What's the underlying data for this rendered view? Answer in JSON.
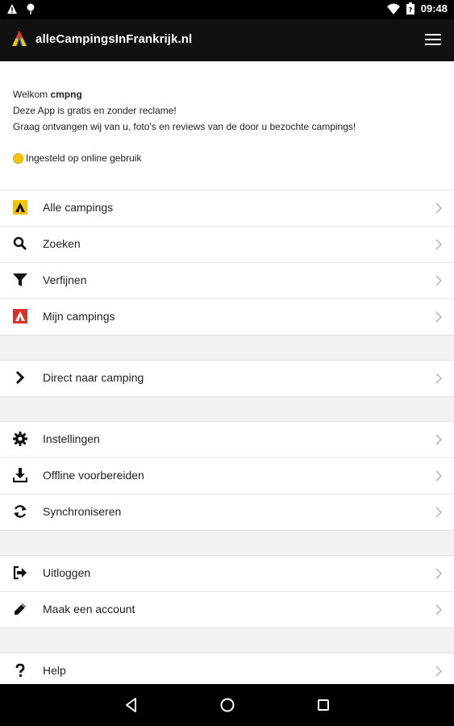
{
  "status_bar": {
    "time": "09:48",
    "left_icons": [
      "warning-icon",
      "location-pin-icon"
    ],
    "right_icons": [
      "wifi-icon",
      "battery-icon"
    ]
  },
  "app_bar": {
    "title": "alleCampingsInFrankrijk.nl",
    "logo_icon": "campings-logo-icon",
    "menu_icon": "hamburger-menu-icon"
  },
  "welcome": {
    "greeting_prefix": "Welkom ",
    "username": "cmpng",
    "line2": "Deze App is gratis en zonder reclame!",
    "line3": "Graag ontvangen wij van u, foto's en reviews van de door u bezochte campings!",
    "status_text": "Ingesteld op online gebruik",
    "status_color": "#f2c500"
  },
  "menu": {
    "group1": [
      {
        "label": "Alle campings",
        "icon": "tent-icon"
      },
      {
        "label": "Zoeken",
        "icon": "search-icon"
      },
      {
        "label": "Verfijnen",
        "icon": "filter-icon"
      },
      {
        "label": "Mijn campings",
        "icon": "my-campings-icon"
      }
    ],
    "group2": [
      {
        "label": "Direct naar camping",
        "icon": "chevron-right-icon"
      }
    ],
    "group3": [
      {
        "label": "Instellingen",
        "icon": "gear-icon"
      },
      {
        "label": "Offline voorbereiden",
        "icon": "download-icon"
      },
      {
        "label": "Synchroniseren",
        "icon": "sync-icon"
      }
    ],
    "group4": [
      {
        "label": "Uitloggen",
        "icon": "logout-icon"
      },
      {
        "label": "Maak een account",
        "icon": "pencil-icon"
      }
    ],
    "group5": [
      {
        "label": "Help",
        "icon": "question-icon"
      }
    ]
  },
  "nav_bar": {
    "back_icon": "back-triangle-icon",
    "home_icon": "home-circle-icon",
    "recents_icon": "recents-square-icon"
  },
  "colors": {
    "app_bar": "#111111",
    "tent_yellow": "#f5c400",
    "mijn_red": "#d9322b",
    "background": "#f2f2f2"
  }
}
